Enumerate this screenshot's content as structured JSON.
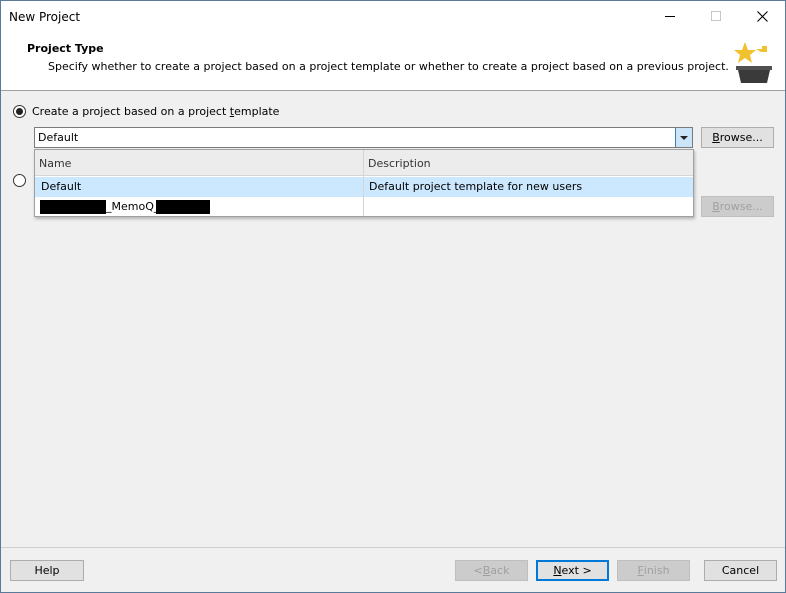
{
  "window": {
    "title": "New Project"
  },
  "header": {
    "title": "Project Type",
    "description": "Specify whether to create a project based on a project template or whether to create a project based on a previous project.",
    "icon": "project-wizard-star-icon"
  },
  "option_template": {
    "label_before": "Create a project based on a project ",
    "label_access": "t",
    "label_after": "emplate",
    "selected": true
  },
  "template_combo": {
    "value": "Default"
  },
  "browse_top": {
    "label_access": "B",
    "label_after": "rowse..."
  },
  "browse_bottom": {
    "label_access": "B",
    "label_after": "rowse...",
    "disabled": true
  },
  "dropdown": {
    "columns": [
      "Name",
      "Description"
    ],
    "rows": [
      {
        "name": "Default",
        "description": "Default project template for new users",
        "selected": true
      },
      {
        "name": "_MemoQ_",
        "description": ""
      }
    ]
  },
  "footer": {
    "help": "Help",
    "back_before": "< ",
    "back_access": "B",
    "back_after": "ack",
    "next_access": "N",
    "next_after": "ext >",
    "finish_access": "F",
    "finish_after": "inish",
    "cancel": "Cancel"
  }
}
